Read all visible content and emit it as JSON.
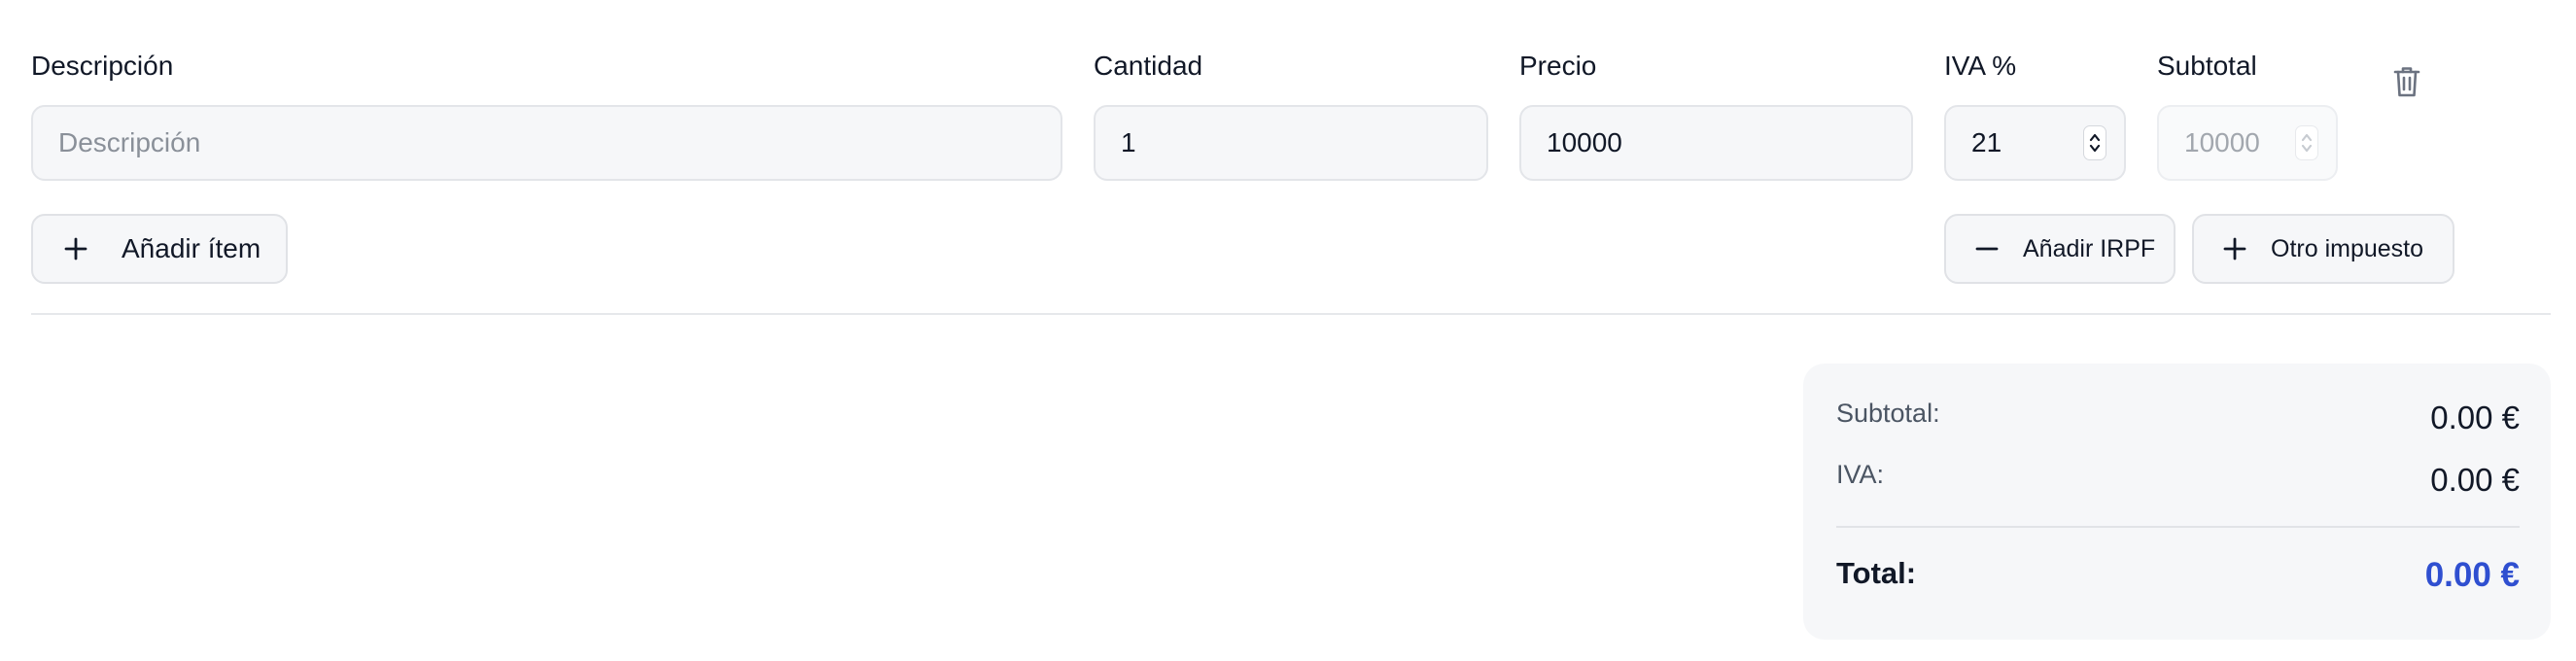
{
  "line_item": {
    "description": {
      "label": "Descripción",
      "placeholder": "Descripción",
      "value": ""
    },
    "quantity": {
      "label": "Cantidad",
      "value": "1"
    },
    "price": {
      "label": "Precio",
      "value": "10000"
    },
    "vat": {
      "label": "IVA %",
      "value": "21"
    },
    "subtotal": {
      "label": "Subtotal",
      "value": "10000"
    }
  },
  "actions": {
    "add_item": "Añadir ítem",
    "add_irpf": "Añadir IRPF",
    "other_tax": "Otro impuesto"
  },
  "totals": {
    "subtotal_label": "Subtotal:",
    "subtotal_value": "0.00 €",
    "vat_label": "IVA:",
    "vat_value": "0.00 €",
    "total_label": "Total:",
    "total_value": "0.00 €"
  },
  "icons": {
    "delete": "trash-icon",
    "add": "plus-icon",
    "remove": "minus-icon",
    "spinner": "chevron-up-down-icon"
  },
  "colors": {
    "accent": "#2f4fd0",
    "input_bg": "#f6f7f9",
    "border": "#e3e5e9"
  }
}
